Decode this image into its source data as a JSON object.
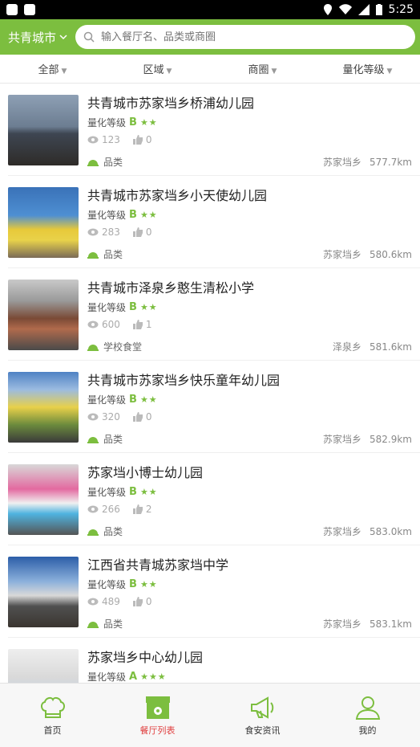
{
  "status": {
    "time": "5:25"
  },
  "header": {
    "city": "共青城市",
    "search_placeholder": "输入餐厅名、品类或商圈"
  },
  "filters": [
    "全部",
    "区域",
    "商圈",
    "量化等级"
  ],
  "list": [
    {
      "title": "共青城市苏家垱乡桥浦幼儿园",
      "rating_label": "量化等级",
      "grade": "B",
      "stars": "★★",
      "views": "123",
      "likes": "0",
      "category": "品类",
      "area": "苏家垱乡",
      "distance": "577.7km"
    },
    {
      "title": "共青城市苏家垱乡小天使幼儿园",
      "rating_label": "量化等级",
      "grade": "B",
      "stars": "★★",
      "views": "283",
      "likes": "0",
      "category": "品类",
      "area": "苏家垱乡",
      "distance": "580.6km"
    },
    {
      "title": "共青城市泽泉乡憨生清松小学",
      "rating_label": "量化等级",
      "grade": "B",
      "stars": "★★",
      "views": "600",
      "likes": "1",
      "category": "学校食堂",
      "area": "泽泉乡",
      "distance": "581.6km"
    },
    {
      "title": "共青城市苏家垱乡快乐童年幼儿园",
      "rating_label": "量化等级",
      "grade": "B",
      "stars": "★★",
      "views": "320",
      "likes": "0",
      "category": "品类",
      "area": "苏家垱乡",
      "distance": "582.9km"
    },
    {
      "title": "苏家垱小博士幼儿园",
      "rating_label": "量化等级",
      "grade": "B",
      "stars": "★★",
      "views": "266",
      "likes": "2",
      "category": "品类",
      "area": "苏家垱乡",
      "distance": "583.0km"
    },
    {
      "title": "江西省共青城苏家垱中学",
      "rating_label": "量化等级",
      "grade": "B",
      "stars": "★★",
      "views": "489",
      "likes": "0",
      "category": "品类",
      "area": "苏家垱乡",
      "distance": "583.1km"
    },
    {
      "title": "苏家垱乡中心幼儿园",
      "rating_label": "量化等级",
      "grade": "A",
      "stars": "★★★",
      "views": "",
      "likes": "",
      "category": "",
      "area": "",
      "distance": ""
    }
  ],
  "bottom_nav": [
    {
      "label": "首页",
      "icon": "chef-hat-icon"
    },
    {
      "label": "餐厅列表",
      "icon": "storefront-icon"
    },
    {
      "label": "食安资讯",
      "icon": "megaphone-icon"
    },
    {
      "label": "我的",
      "icon": "user-icon"
    }
  ],
  "colors": {
    "accent": "#7cbe3f",
    "active": "#e04040"
  }
}
